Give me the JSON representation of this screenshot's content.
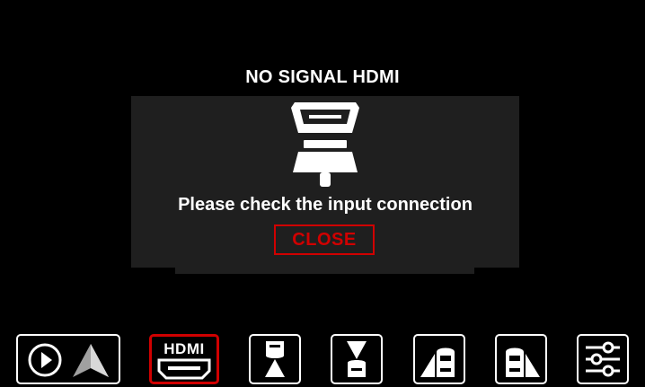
{
  "screen": {
    "title": "NO SIGNAL HDMI"
  },
  "dialog": {
    "message": "Please check the input connection",
    "close_label": "CLOSE",
    "illustration": "hdmi-connector-icon"
  },
  "dock": {
    "items": [
      {
        "id": "carplay-android-auto",
        "icon": "play-navigation-icon",
        "active": false
      },
      {
        "id": "hdmi",
        "label": "HDMI",
        "icon": "hdmi-port-icon",
        "active": true
      },
      {
        "id": "front-camera",
        "icon": "front-camera-icon",
        "active": false
      },
      {
        "id": "rear-camera",
        "icon": "rear-camera-icon",
        "active": false
      },
      {
        "id": "left-camera",
        "icon": "left-camera-icon",
        "active": false
      },
      {
        "id": "right-camera",
        "icon": "right-camera-icon",
        "active": false
      },
      {
        "id": "settings",
        "icon": "settings-sliders-icon",
        "active": false
      }
    ]
  },
  "colors": {
    "background": "#000000",
    "dialog": "#1f1f1f",
    "accent": "#d00000",
    "text": "#ffffff"
  }
}
